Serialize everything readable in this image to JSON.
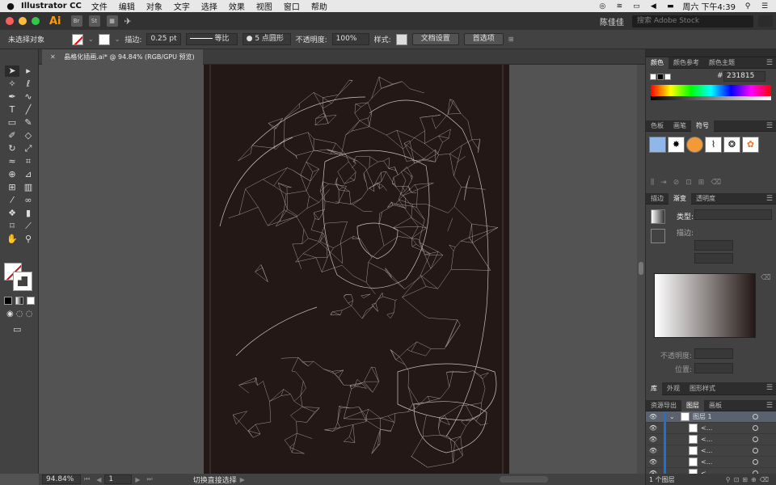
{
  "menubar": {
    "app_name": "Illustrator CC",
    "items": [
      "文件",
      "编辑",
      "对象",
      "文字",
      "选择",
      "效果",
      "视图",
      "窗口",
      "帮助"
    ],
    "clock": "周六 下午4:39"
  },
  "appbar": {
    "logo": "Ai",
    "bridge_label": "Br",
    "stock_label": "St",
    "user": "陈佳佳",
    "search_placeholder": "搜索 Adobe Stock"
  },
  "controlbar": {
    "selection_label": "未选择对象",
    "stroke_label": "描边:",
    "stroke_weight": "0.25 pt",
    "stroke_profile": "等比",
    "brush": "5 点圆形",
    "opacity_label": "不透明度:",
    "opacity_value": "100%",
    "style_label": "样式:",
    "doc_settings": "文档设置",
    "preferences": "首选项"
  },
  "document": {
    "tab_title": "晶格化插画.ai* @ 94.84% (RGB/GPU 预览)",
    "artboard_color": "#231815",
    "line_color": "#c9c0bd"
  },
  "statusbar": {
    "zoom": "94.84%",
    "page": "1",
    "status": "切换直接选择"
  },
  "panels": {
    "color_tabs": [
      "颜色",
      "颜色参考",
      "颜色主题"
    ],
    "hex_label": "#",
    "hex_value": "231815",
    "swatch_tabs": [
      "色板",
      "画笔",
      "符号"
    ],
    "gradient_tabs": [
      "描边",
      "渐变",
      "透明度"
    ],
    "gradient_type_label": "类型:",
    "gradient_stroke_label": "描边:",
    "gradient_opacity_label": "不透明度:",
    "gradient_position_label": "位置:",
    "library_tabs": [
      "库",
      "外观",
      "图形样式"
    ],
    "layer_tabs": [
      "资源导出",
      "图层",
      "画板"
    ],
    "layers": [
      {
        "name": "图层 1",
        "level": 0
      },
      {
        "name": "<...",
        "level": 1
      },
      {
        "name": "<...",
        "level": 1
      },
      {
        "name": "<...",
        "level": 1
      },
      {
        "name": "<...",
        "level": 1
      },
      {
        "name": "<...",
        "level": 1
      }
    ],
    "layer_count": "1 个图层"
  }
}
